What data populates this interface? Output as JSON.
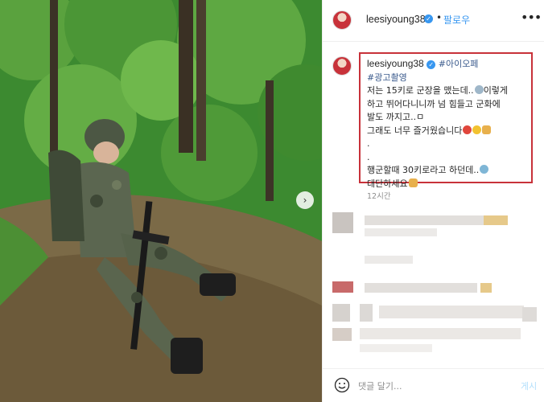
{
  "post": {
    "username": "leesiyoung38",
    "follow_label": "팔로우",
    "separator": "•",
    "more_label": "•••",
    "caption": {
      "username": "leesiyoung38",
      "hashtag1": "#아이오페",
      "hashtag2": "#광고촬영",
      "line1": "저는 15키로 군장을 맸는데..",
      "line1b": "이렇게",
      "line2": "하고 뛰어다니니까 넘 힘들고 군화에",
      "line3": "발도 까지고..ㅁ",
      "line4": "그래도 너무 즐거웠습니다",
      "dot1": ".",
      "dot2": ".",
      "line5": "행군할때 30키로라고 하던데..",
      "line6": "대단하세요"
    },
    "timestamp": "12시간",
    "comment_placeholder": "댓글 달기...",
    "post_button": "게시",
    "next_arrow": "›"
  },
  "colors": {
    "highlight_border": "#c8323a",
    "link_blue": "#3897f0",
    "hashtag": "#3a5a8c"
  },
  "icons": [
    "verified-badge-icon",
    "more-options-icon",
    "emoji-smile-icon",
    "next-photo-arrow-icon"
  ]
}
